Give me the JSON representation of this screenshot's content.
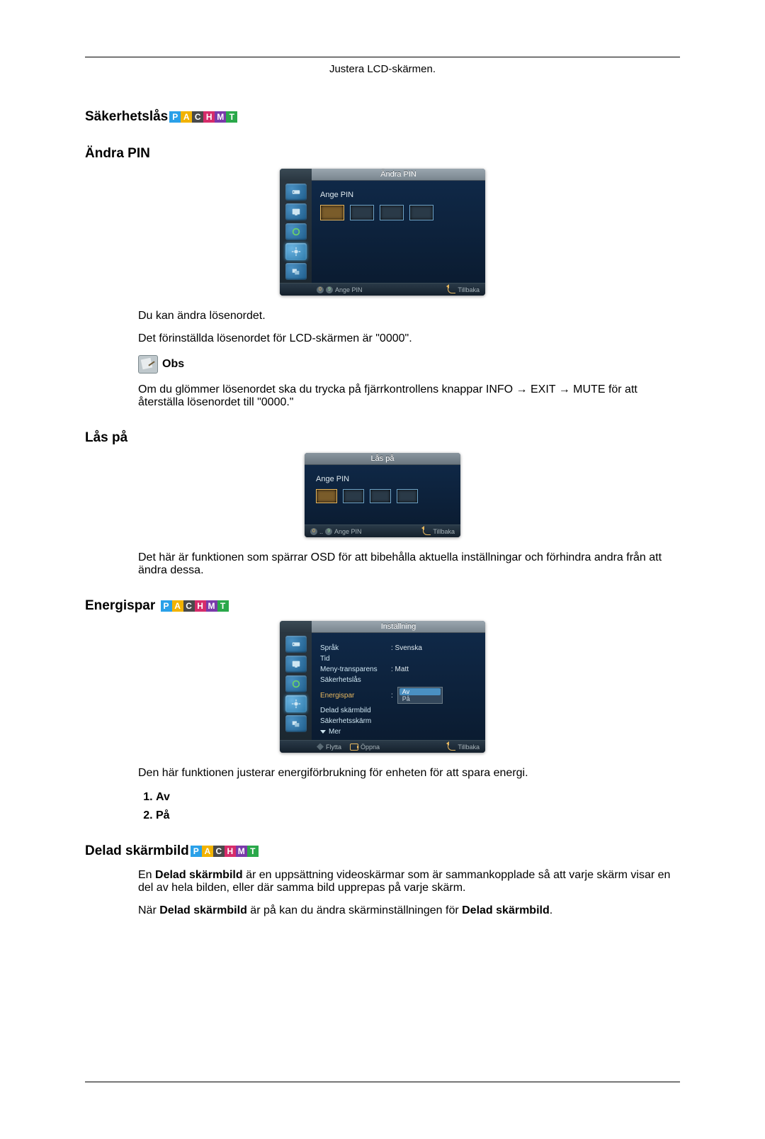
{
  "header_title": "Justera LCD-skärmen.",
  "badges": [
    "P",
    "A",
    "C",
    "H",
    "M",
    "T"
  ],
  "sections": {
    "safety_lock_heading": "Säkerhetslås",
    "change_pin_heading": "Ändra PIN",
    "change_pin_osd": {
      "title": "Ändra PIN",
      "enter_pin": "Ange PIN",
      "footer_enter_pin": "Ange PIN",
      "footer_back": "Tillbaka"
    },
    "change_pin_body1": "Du kan ändra lösenordet.",
    "change_pin_body2": "Det förinställda lösenordet för LCD-skärmen är \"0000\".",
    "note_label": "Obs",
    "note_body": "Om du glömmer lösenordet ska du trycka på fjärrkontrollens knappar INFO → EXIT → MUTE för att återställa lösenordet till \"0000.\"",
    "lock_on_heading": "Lås på",
    "lock_on_osd": {
      "title": "Lås på",
      "enter_pin": "Ange PIN",
      "footer_enter_pin": "Ange PIN",
      "footer_back": "Tillbaka"
    },
    "lock_on_body": "Det här är funktionen som spärrar OSD för att bibehålla aktuella inställningar och förhindra andra från att ändra dessa.",
    "energy_heading": "Energispar",
    "energy_osd": {
      "title": "Inställning",
      "rows": {
        "lang_k": "Språk",
        "lang_v": ": Svenska",
        "time_k": "Tid",
        "menutrans_k": "Meny-transparens",
        "menutrans_v": ": Matt",
        "safety_k": "Säkerhetslås",
        "energispar_k": "Energispar",
        "opt_off": "Av",
        "opt_on": "På",
        "videowall_k": "Delad skärmbild",
        "safescreen_k": "Säkerhetsskärm",
        "more": "Mer"
      },
      "footer_move": "Flytta",
      "footer_open": "Öppna",
      "footer_back": "Tillbaka"
    },
    "energy_body": "Den här funktionen justerar energiförbrukning för enheten för att spara energi.",
    "energy_options": [
      "Av",
      "På"
    ],
    "videowall_heading": "Delad skärmbild",
    "videowall_p1_a": "En ",
    "videowall_p1_b": "Delad skärmbild",
    "videowall_p1_c": " är en uppsättning videoskärmar som är sammankopplade så att varje skärm visar en del av hela bilden, eller där samma bild upprepas på varje skärm.",
    "videowall_p2_a": "När ",
    "videowall_p2_b": "Delad skärmbild",
    "videowall_p2_c": " är på kan du ändra skärminställningen för ",
    "videowall_p2_d": "Delad skärmbild",
    "videowall_p2_e": "."
  }
}
